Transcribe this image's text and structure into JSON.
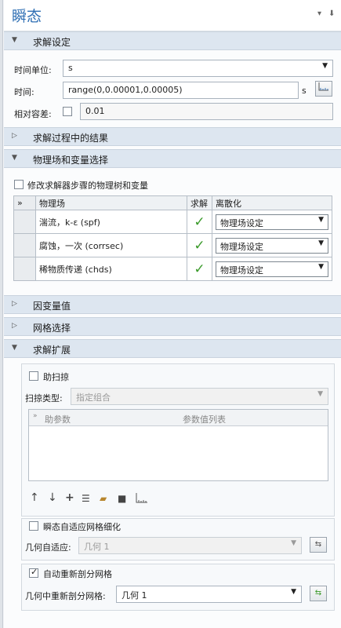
{
  "title": "瞬态",
  "title_controls": {
    "menu": "▾",
    "pin": "⬇"
  },
  "sections": {
    "solve_settings": "求解设定",
    "results_during": "求解过程中的结果",
    "physics_vars": "物理场和变量选择",
    "dependent_values": "因变量值",
    "mesh_select": "网格选择",
    "solve_extension": "求解扩展"
  },
  "solve_settings": {
    "time_unit_label": "时间单位:",
    "time_unit_value": "s",
    "time_label": "时间:",
    "time_value": "range(0,0.00001,0.00005)",
    "time_suffix": "s",
    "rel_tol_label": "相对容差:",
    "rel_tol_value": "0.01"
  },
  "physics": {
    "modify_label": "修改求解器步骤的物理树和变量",
    "col_physics": "物理场",
    "col_solve": "求解",
    "col_disc": "离散化",
    "rows": [
      {
        "name": "湍流，k-ε (spf)",
        "disc": "物理场设定"
      },
      {
        "name": "腐蚀，一次 (corrsec)",
        "disc": "物理场设定"
      },
      {
        "name": "稀物质传递 (chds)",
        "disc": "物理场设定"
      }
    ]
  },
  "extension": {
    "aux_sweep": "助扫掠",
    "sweep_type_label": "扫掠类型:",
    "sweep_type_value": "指定组合",
    "col_param": "助参数",
    "col_values": "参数值列表",
    "adaptive_label": "瞬态自适应网格细化",
    "geom_adapt_label": "几何自适应:",
    "geom_adapt_value": "几何 1",
    "auto_remesh_label": "自动重新剖分网格",
    "geom_remesh_label": "几何中重新剖分网格:",
    "geom_remesh_value": "几何 1"
  },
  "accent_color": "#2f6fb4"
}
